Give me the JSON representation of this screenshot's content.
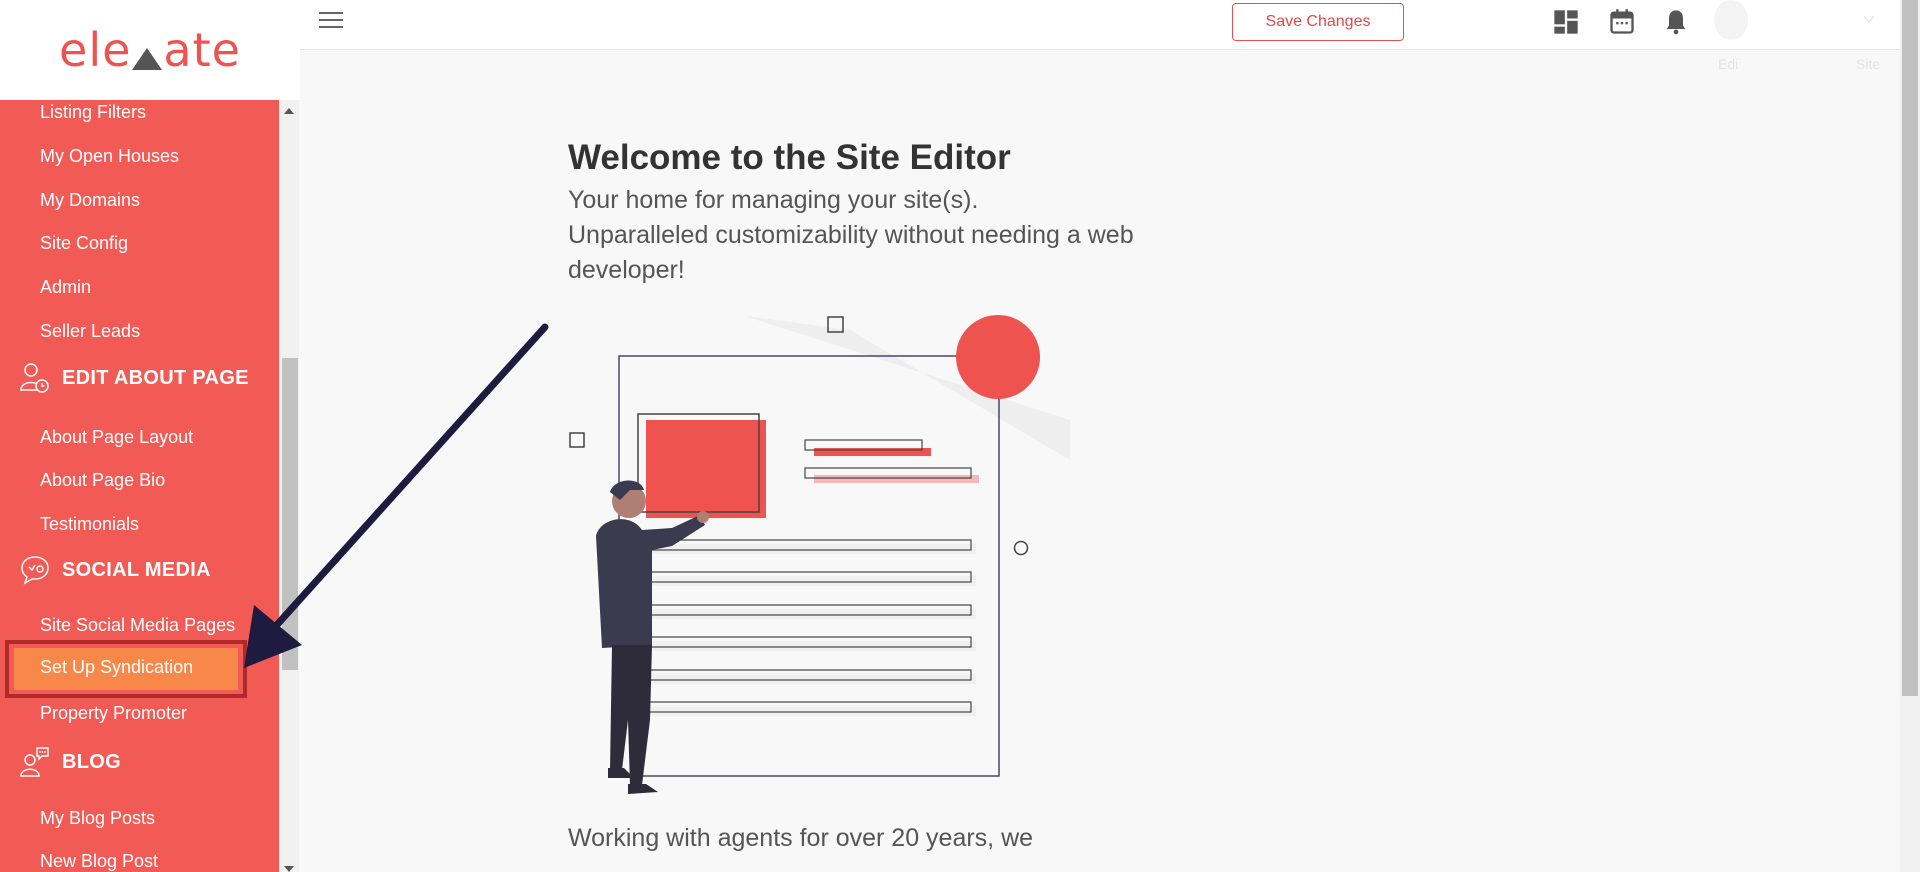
{
  "brand": {
    "logo_prefix": "ele",
    "logo_suffix": "ate",
    "accent": "#f25a55",
    "active_color": "#f7884a"
  },
  "sidebar": {
    "items_top": [
      {
        "label": "Listing Filters"
      },
      {
        "label": "My Open Houses"
      },
      {
        "label": "My Domains"
      },
      {
        "label": "Site Config"
      },
      {
        "label": "Admin"
      },
      {
        "label": "Seller Leads"
      }
    ],
    "section_about": {
      "title": "EDIT ABOUT PAGE",
      "icon": "user-clock-icon"
    },
    "items_about": [
      {
        "label": "About Page Layout"
      },
      {
        "label": "About Page Bio"
      },
      {
        "label": "Testimonials"
      }
    ],
    "section_social": {
      "title": "SOCIAL MEDIA",
      "icon": "social-bubble-icon"
    },
    "items_social": [
      {
        "label": "Site Social Media Pages"
      },
      {
        "label": "Set Up Syndication",
        "active": true
      },
      {
        "label": "Property Promoter"
      }
    ],
    "section_blog": {
      "title": "BLOG",
      "icon": "user-chat-icon"
    },
    "items_blog": [
      {
        "label": "My Blog Posts"
      },
      {
        "label": "New Blog Post"
      }
    ]
  },
  "topbar": {
    "save_label": "Save Changes",
    "icons": [
      "dashboard-icon",
      "calendar-icon",
      "bell-icon",
      "avatar-icon",
      "chevron-down-icon"
    ],
    "faded_left": "Edi",
    "faded_right": "Site"
  },
  "main": {
    "title": "Welcome to the Site Editor",
    "subtitle_lines": [
      "Your home for managing your site(s).",
      "Unparalleled customizability without needing a web",
      "developer!"
    ],
    "bottom_lines": [
      "Working with agents for over 20 years, we"
    ]
  }
}
